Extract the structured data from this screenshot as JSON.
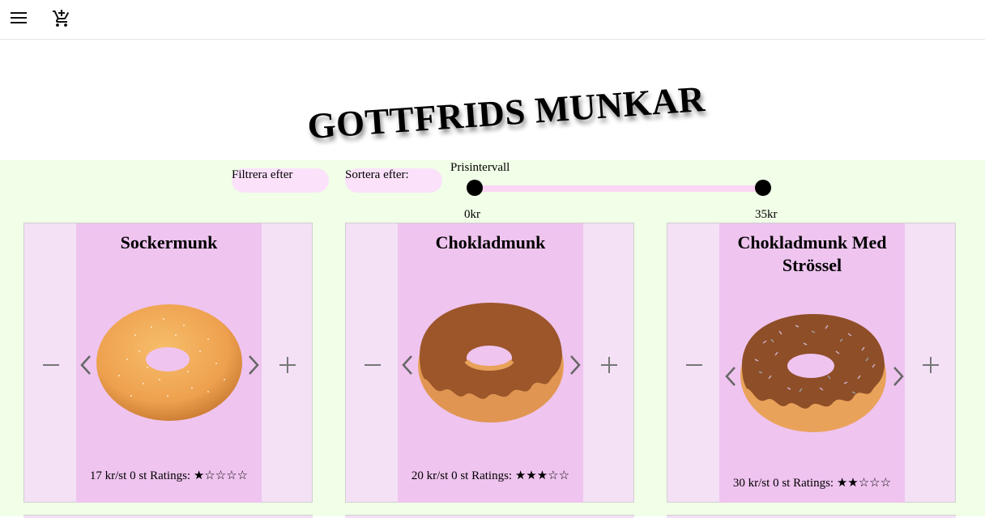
{
  "header": {
    "menu_icon": "menu-icon",
    "cart_icon": "cart-icon"
  },
  "brand": {
    "title": "GOTTFRIDS MUNKAR"
  },
  "filters": {
    "filter_label": "Filtrera efter",
    "sort_label": "Sortera efter:",
    "price_range_label": "Prisintervall",
    "price_min_label": "0kr",
    "price_max_label": "35kr",
    "price_min": 0,
    "price_max": 35
  },
  "products": [
    {
      "name": "Sockermunk",
      "price": "17 kr/st",
      "quantity": "0 st",
      "ratings_label": "Ratings:",
      "stars": "★☆☆☆☆",
      "rating": 1,
      "donut_style": "sugar"
    },
    {
      "name": "Chokladmunk",
      "price": "20 kr/st",
      "quantity": "0 st",
      "ratings_label": "Ratings:",
      "stars": "★★★☆☆",
      "rating": 3,
      "donut_style": "chocolate"
    },
    {
      "name": "Chokladmunk Med Strössel",
      "price": "30 kr/st",
      "quantity": "0 st",
      "ratings_label": "Ratings:",
      "stars": "★★☆☆☆",
      "rating": 2,
      "donut_style": "chocolate-sprinkles"
    }
  ],
  "colors": {
    "page_bg": "#f1ffe8",
    "card_bg": "#f4e1f6",
    "card_center": "#efc4ef",
    "pill_bg": "#fbe2fa",
    "track": "#fbd5f4"
  }
}
